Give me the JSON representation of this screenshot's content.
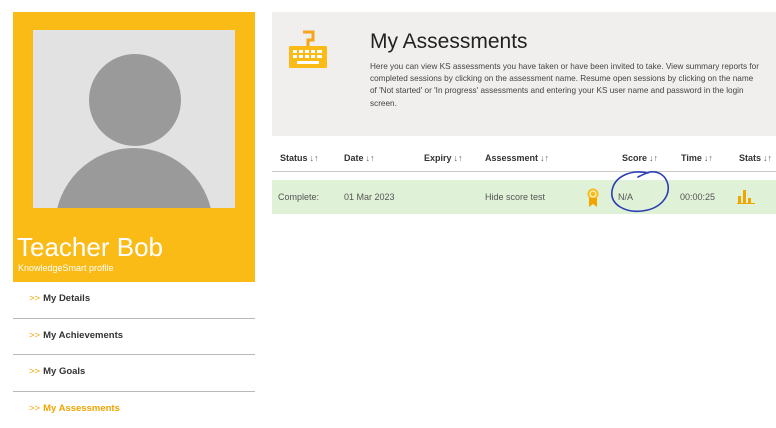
{
  "profile": {
    "name": "Teacher Bob",
    "subtitle": "KnowledgeSmart profile"
  },
  "nav": {
    "arrow": ">>",
    "items": [
      {
        "label": "My Details"
      },
      {
        "label": "My Achievements"
      },
      {
        "label": "My Goals"
      },
      {
        "label": "My Assessments"
      }
    ]
  },
  "header": {
    "title": "My Assessments",
    "description": "Here you can view KS assessments you have taken or have been invited to take. View summary reports for completed sessions by clicking on the assessment name. Resume open sessions by clicking on the name of 'Not started' or 'In progress' assessments and entering your KS user name and password in the login screen."
  },
  "table": {
    "sort_glyph": "↓↑",
    "columns": [
      {
        "label": "Status"
      },
      {
        "label": "Date"
      },
      {
        "label": "Expiry"
      },
      {
        "label": "Assessment"
      },
      {
        "label": "Score"
      },
      {
        "label": "Time"
      },
      {
        "label": "Stats"
      }
    ],
    "rows": [
      {
        "status": "Complete:",
        "date": "01 Mar 2023",
        "expiry": "",
        "assessment": "Hide score test",
        "score": "N/A",
        "time": "00:00:25"
      }
    ]
  },
  "colors": {
    "accent": "#fbbb17",
    "row_complete": "#dff1d7",
    "header_bg": "#f0efed",
    "annotation": "#2b3fb3"
  },
  "icons": [
    "keyboard-icon",
    "medal-icon",
    "stats-icon",
    "avatar-placeholder"
  ]
}
